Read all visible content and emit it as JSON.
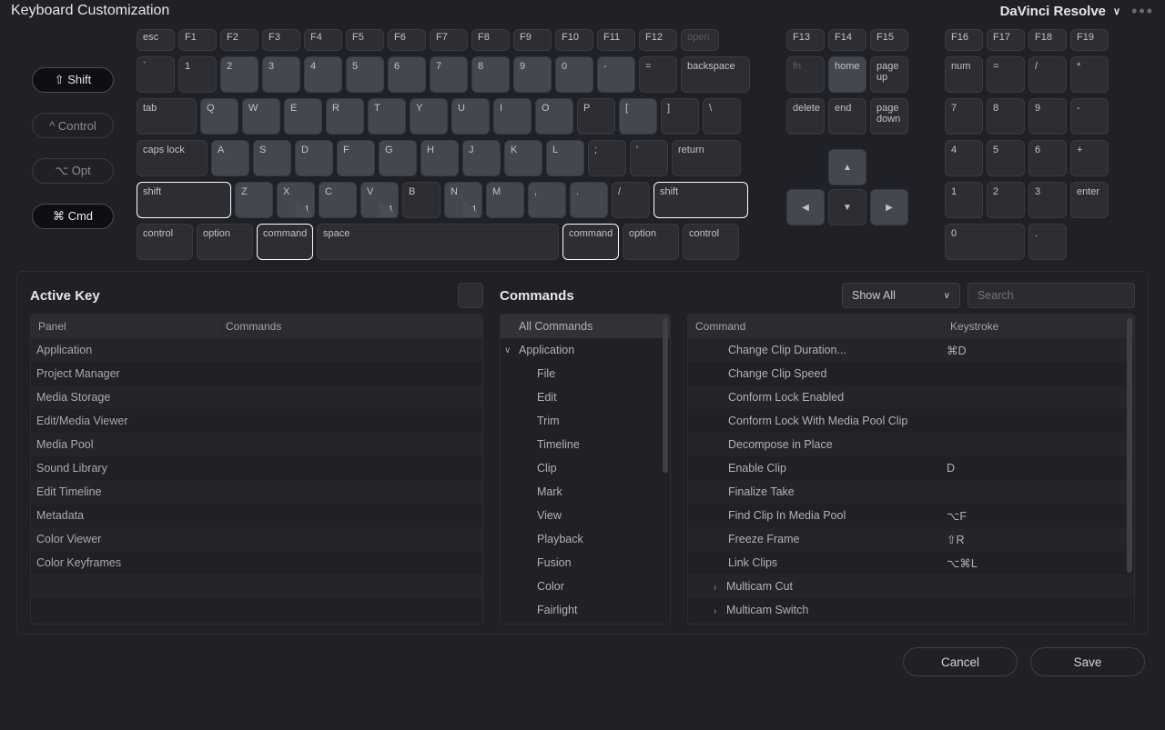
{
  "header": {
    "title": "Keyboard Customization",
    "preset": "DaVinci Resolve"
  },
  "modifiers": [
    {
      "label": "⇧ Shift",
      "active": true
    },
    {
      "label": "^ Control",
      "active": false
    },
    {
      "label": "⌥ Opt",
      "active": false
    },
    {
      "label": "⌘ Cmd",
      "active": true
    }
  ],
  "keyboard": {
    "frow": [
      "esc",
      "F1",
      "F2",
      "F3",
      "F4",
      "F5",
      "F6",
      "F7",
      "F8",
      "F9",
      "F10",
      "F11",
      "F12",
      "open"
    ],
    "row1": [
      "`",
      "1",
      "2",
      "3",
      "4",
      "5",
      "6",
      "7",
      "8",
      "9",
      "0",
      "-",
      "=",
      "backspace"
    ],
    "row2": [
      "tab",
      "Q",
      "W",
      "E",
      "R",
      "T",
      "Y",
      "U",
      "I",
      "O",
      "P",
      "[",
      "]",
      "\\"
    ],
    "row3": [
      "caps lock",
      "A",
      "S",
      "D",
      "F",
      "G",
      "H",
      "J",
      "K",
      "L",
      ";",
      "'",
      "return"
    ],
    "row4": [
      "shift",
      "Z",
      "X",
      "C",
      "V",
      "B",
      "N",
      "M",
      ",",
      ".",
      "/",
      "shift"
    ],
    "row5": [
      "control",
      "option",
      "command",
      "space",
      "command",
      "option",
      "control"
    ],
    "cluster_top": [
      "F13",
      "F14",
      "F15"
    ],
    "cluster_r1": [
      "fn",
      "home",
      "page up"
    ],
    "cluster_r2": [
      "delete",
      "end",
      "page down"
    ],
    "arrows": {
      "up": "▲",
      "left": "◀",
      "down": "▼",
      "right": "▶"
    },
    "num_top": [
      "F16",
      "F17",
      "F18",
      "F19"
    ],
    "num_r1": [
      "num",
      "=",
      "/",
      "*"
    ],
    "num_r2": [
      "7",
      "8",
      "9",
      "-"
    ],
    "num_r3": [
      "4",
      "5",
      "6",
      "+"
    ],
    "num_r4": [
      "1",
      "2",
      "3",
      "enter"
    ],
    "num_r5": [
      "0",
      "."
    ]
  },
  "active_key": {
    "title": "Active Key",
    "columns": [
      "Panel",
      "Commands"
    ],
    "rows": [
      "Application",
      "Project Manager",
      "Media Storage",
      "Edit/Media Viewer",
      "Media Pool",
      "Sound Library",
      "Edit Timeline",
      "Metadata",
      "Color Viewer",
      "Color Keyframes"
    ]
  },
  "commands_tree": {
    "title": "Commands",
    "root": "All Commands",
    "expanded": "Application",
    "children": [
      "File",
      "Edit",
      "Trim",
      "Timeline",
      "Clip",
      "Mark",
      "View",
      "Playback",
      "Fusion",
      "Color",
      "Fairlight"
    ]
  },
  "commands_list": {
    "filter_label": "Show All",
    "search_placeholder": "Search",
    "columns": [
      "Command",
      "Keystroke"
    ],
    "rows": [
      {
        "cmd": "Change Clip Duration...",
        "key": "⌘D"
      },
      {
        "cmd": "Change Clip Speed",
        "key": ""
      },
      {
        "cmd": "Conform Lock Enabled",
        "key": ""
      },
      {
        "cmd": "Conform Lock With Media Pool Clip",
        "key": ""
      },
      {
        "cmd": "Decompose in Place",
        "key": ""
      },
      {
        "cmd": "Enable Clip",
        "key": "D"
      },
      {
        "cmd": "Finalize Take",
        "key": ""
      },
      {
        "cmd": "Find Clip In Media Pool",
        "key": "⌥F"
      },
      {
        "cmd": "Freeze Frame",
        "key": "⇧R"
      },
      {
        "cmd": "Link Clips",
        "key": "⌥⌘L"
      },
      {
        "cmd": "Multicam Cut",
        "key": "",
        "expandable": true
      },
      {
        "cmd": "Multicam Switch",
        "key": "",
        "expandable": true
      }
    ]
  },
  "footer": {
    "cancel": "Cancel",
    "save": "Save"
  }
}
